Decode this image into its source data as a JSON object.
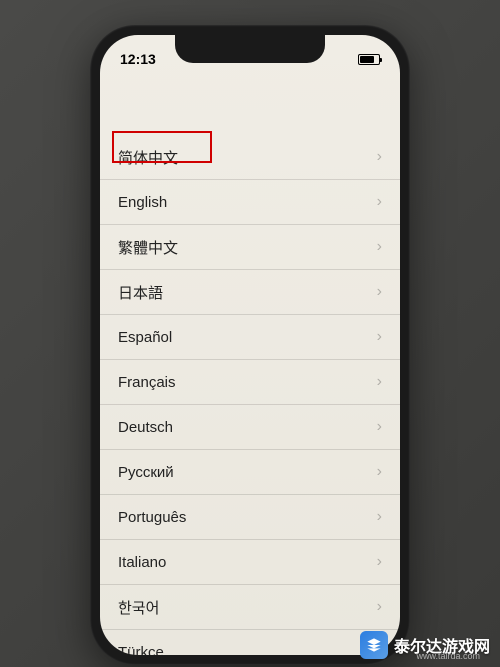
{
  "status_bar": {
    "time": "12:13"
  },
  "languages": [
    {
      "label": "简体中文",
      "highlighted": true
    },
    {
      "label": "English"
    },
    {
      "label": "繁體中文"
    },
    {
      "label": "日本語"
    },
    {
      "label": "Español"
    },
    {
      "label": "Français"
    },
    {
      "label": "Deutsch"
    },
    {
      "label": "Русский"
    },
    {
      "label": "Português"
    },
    {
      "label": "Italiano"
    },
    {
      "label": "한국어"
    },
    {
      "label": "Türkçe"
    }
  ],
  "watermark": {
    "text": "泰尔达游戏网",
    "url": "www.tairda.com"
  }
}
